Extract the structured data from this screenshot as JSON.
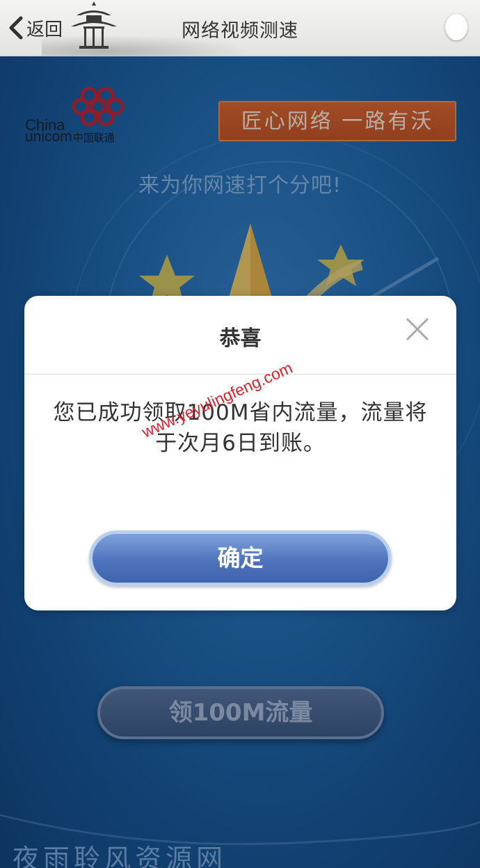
{
  "nav": {
    "back_label": "返回",
    "title": "网络视频测速"
  },
  "brand": {
    "logo_line1": "China",
    "logo_line2": "unicom",
    "logo_cn": "中国联通",
    "slogan": "匠心网络 一路有沃"
  },
  "main": {
    "prompt": "来为你网速打个分吧!",
    "claim_button_label": "领100M流量"
  },
  "dialog": {
    "title": "恭喜",
    "message": "您已成功领取100M省内流量，流量将于次月6日到账。",
    "confirm_label": "确定"
  },
  "watermarks": {
    "diagonal": "www.yeyulingfeng.com",
    "bottom": "夜雨聆风资源网"
  },
  "colors": {
    "background_blue": "#1a5a92",
    "slogan_orange": "#d45a1a",
    "button_blue": "#4f74bd",
    "watermark_red": "#e0202a",
    "logo_red": "#c0202a"
  }
}
